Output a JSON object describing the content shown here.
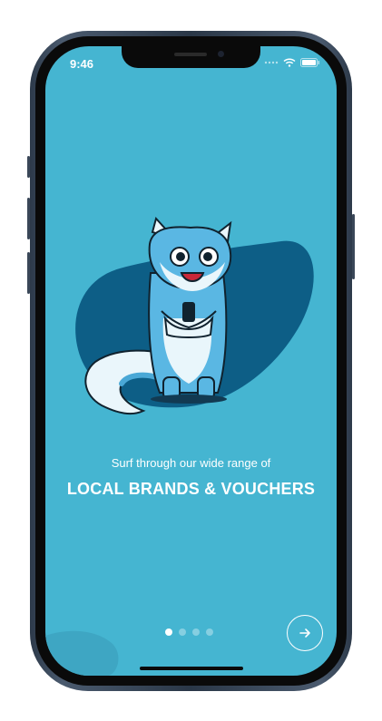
{
  "status_bar": {
    "time": "9:46",
    "icons": [
      "signal-dots-icon",
      "wifi-icon",
      "battery-icon"
    ]
  },
  "onboarding": {
    "subtitle": "Surf through our wide range of",
    "headline": "LOCAL BRANDS & VOUCHERS",
    "illustration": "fox-mascot-holding-phone",
    "pagination": {
      "total": 4,
      "active": 1
    },
    "next_icon": "arrow-right-icon"
  },
  "colors": {
    "screen_background": "#45b5d1",
    "blob": "#0d5e86",
    "accent": "#ffffff"
  }
}
